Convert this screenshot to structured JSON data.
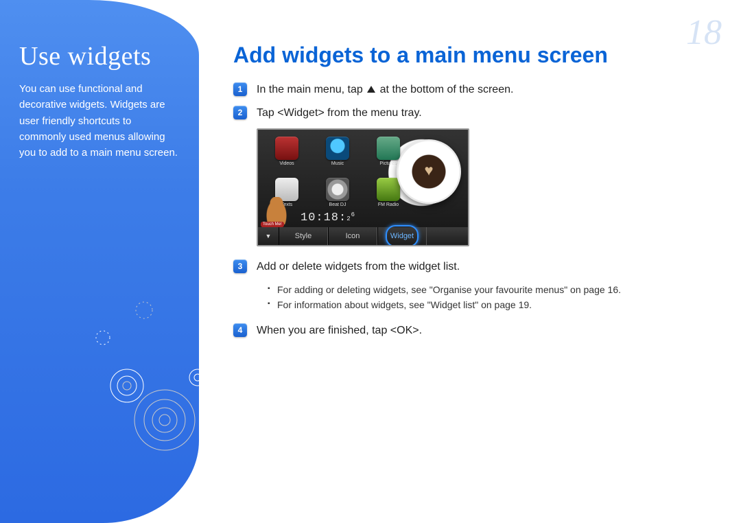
{
  "page_number": "18",
  "sidebar": {
    "title": "Use widgets",
    "body": "You can use functional and decorative widgets.\nWidgets are user friendly shortcuts to commonly used menus allowing you to add to a main menu screen."
  },
  "main": {
    "heading": "Add widgets to a main menu screen",
    "steps": [
      {
        "n": "1",
        "pre": "In the main menu, tap ",
        "post": " at the bottom of the screen."
      },
      {
        "n": "2",
        "text": "Tap <Widget> from the menu tray."
      },
      {
        "n": "3",
        "text": "Add or delete widgets from the widget list."
      },
      {
        "n": "4",
        "text": "When you are finished, tap <OK>."
      }
    ],
    "sub_bullets": [
      "For adding or deleting widgets, see \"Organise your favourite menus\" on page 16.",
      "For information about widgets, see \"Widget list\" on page 19."
    ]
  },
  "device": {
    "apps": [
      {
        "name": "Videos",
        "cls": "videos"
      },
      {
        "name": "Music",
        "cls": "music"
      },
      {
        "name": "Pictures",
        "cls": "pictures"
      },
      {
        "name": "Texts",
        "cls": "texts"
      },
      {
        "name": "Beat DJ",
        "cls": "beat"
      },
      {
        "name": "FM Radio",
        "cls": "fm"
      }
    ],
    "touch_label": "Touch Me!",
    "clock": "10:18",
    "clock_sec": "2",
    "clock_sup": "6",
    "tray": {
      "style": "Style",
      "icon": "Icon",
      "widget": "Widget"
    }
  }
}
